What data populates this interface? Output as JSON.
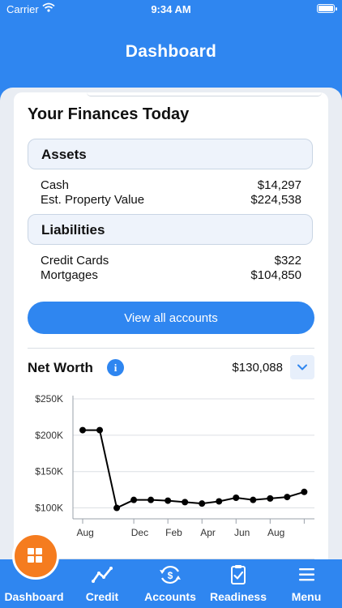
{
  "status": {
    "carrier": "Carrier",
    "time": "9:34 AM"
  },
  "header": {
    "title": "Dashboard"
  },
  "finances": {
    "title": "Your Finances Today",
    "assets": {
      "heading": "Assets",
      "rows": [
        {
          "label": "Cash",
          "value": "$14,297"
        },
        {
          "label": "Est. Property Value",
          "value": "$224,538"
        }
      ]
    },
    "liabilities": {
      "heading": "Liabilities",
      "rows": [
        {
          "label": "Credit Cards",
          "value": "$322"
        },
        {
          "label": "Mortgages",
          "value": "$104,850"
        }
      ]
    },
    "view_all_label": "View all accounts"
  },
  "net_worth": {
    "title": "Net Worth",
    "info_glyph": "i",
    "value": "$130,088"
  },
  "chart_data": {
    "type": "line",
    "x": [
      0,
      1,
      2,
      3,
      4,
      5,
      6,
      7,
      8,
      9,
      10,
      11,
      12,
      13
    ],
    "x_tick_positions": [
      0,
      3,
      5,
      7,
      9,
      11,
      13
    ],
    "x_tick_labels": [
      "Aug",
      "Dec",
      "Feb",
      "Apr",
      "Jun",
      "Aug"
    ],
    "series": [
      {
        "values": [
          207,
          207,
          100,
          111,
          111,
          110,
          108,
          106,
          109,
          114,
          111,
          113,
          115,
          122
        ]
      }
    ],
    "y_ticks": [
      100,
      150,
      200,
      250
    ],
    "y_tick_labels": [
      "$100K",
      "$150K",
      "$200K",
      "$250K"
    ],
    "ylim": [
      85,
      250
    ],
    "grid": true,
    "line_color": "#000000"
  },
  "tabs": [
    {
      "label": "Dashboard",
      "icon": "grid-icon"
    },
    {
      "label": "Credit",
      "icon": "trend-icon"
    },
    {
      "label": "Accounts",
      "icon": "dollar-cycle-icon"
    },
    {
      "label": "Readiness",
      "icon": "clipboard-check-icon"
    },
    {
      "label": "Menu",
      "icon": "hamburger-icon"
    }
  ],
  "colors": {
    "primary": "#2f86f0",
    "fab": "#f57c1f"
  }
}
